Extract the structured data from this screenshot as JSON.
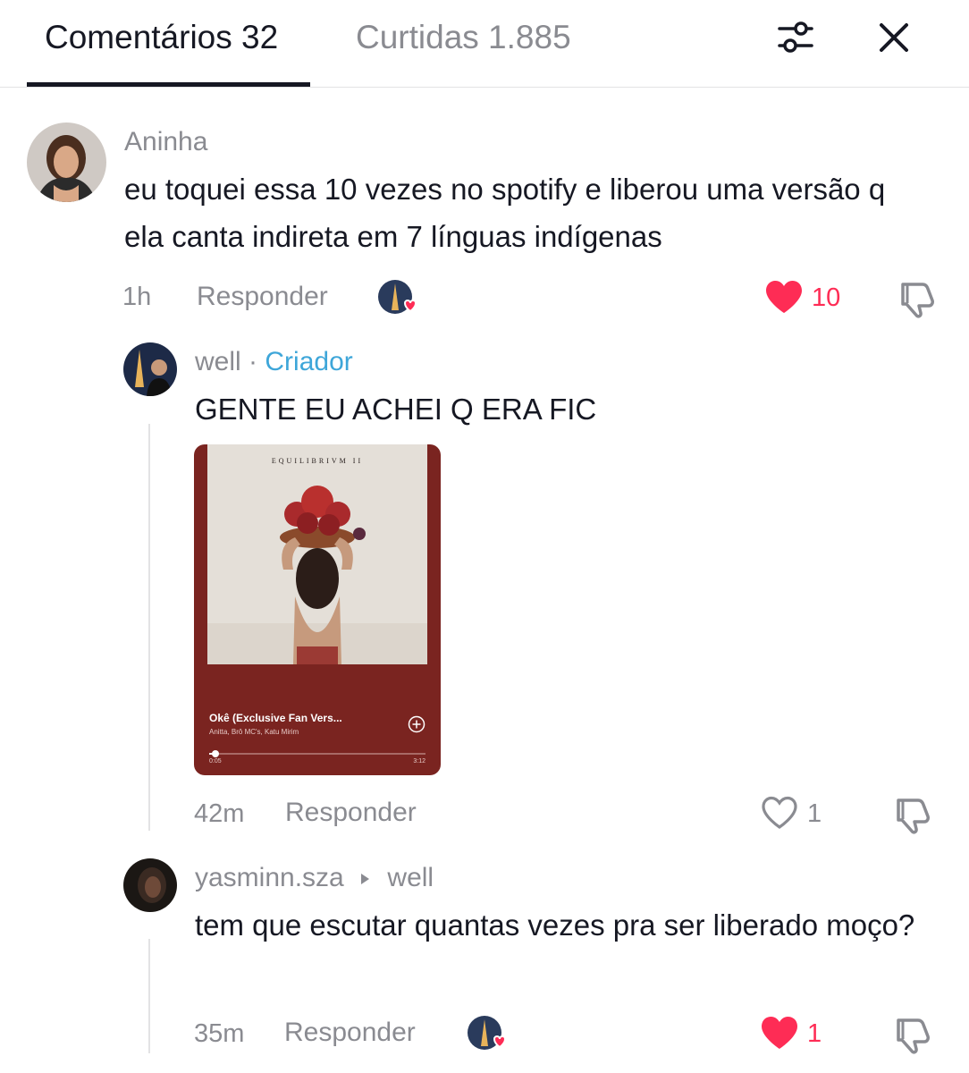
{
  "header": {
    "tab_comments": "Comentários 32",
    "tab_likes": "Curtidas 1.885",
    "filter_icon": "sliders-icon",
    "close_icon": "close-icon"
  },
  "comments": [
    {
      "username": "Aninha",
      "text": "eu toquei essa 10 vezes no spotify e liberou uma versão q ela canta indireta em 7 línguas indígenas",
      "time": "1h",
      "reply_label": "Responder",
      "liked_by_creator": true,
      "likes": "10",
      "liked": true
    },
    {
      "username": "well",
      "separator": "·",
      "badge": "Criador",
      "text": "GENTE EU ACHEI Q ERA FIC",
      "time": "42m",
      "reply_label": "Responder",
      "likes": "1",
      "liked": false,
      "spotify_card": {
        "cover_title": "EQUILIBRIVM II",
        "song_title": "Okê (Exclusive Fan Vers...",
        "artists": "Anitta, Brô MC's, Katu Mirim",
        "time_start": "0:05",
        "time_end": "3:12",
        "progress": 0.03
      }
    },
    {
      "username": "yasminn.sza",
      "reply_to": "well",
      "text": "tem que escutar quantas vezes pra ser liberado moço?",
      "time": "35m",
      "reply_label": "Responder",
      "liked_by_creator": true,
      "likes": "1",
      "liked": true
    }
  ],
  "colors": {
    "liked": "#fe2c55",
    "creator_badge": "#3ea6d9",
    "secondary_text": "#8a8b91",
    "card_background": "#7a2420"
  }
}
